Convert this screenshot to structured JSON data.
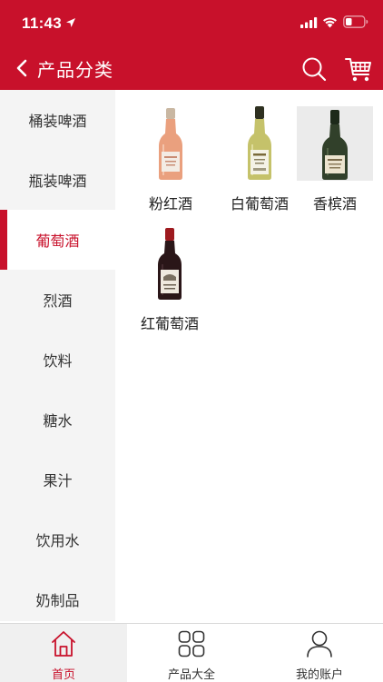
{
  "status_bar": {
    "time": "11:43"
  },
  "nav": {
    "title": "产品分类",
    "icons": [
      "back-chevron-icon",
      "search-icon",
      "cart-icon"
    ]
  },
  "colors": {
    "accent": "#c8112b",
    "sidebar_bg": "#f4f4f4"
  },
  "sidebar": {
    "items": [
      {
        "label": "桶装啤酒",
        "active": false
      },
      {
        "label": "瓶装啤酒",
        "active": false
      },
      {
        "label": "葡萄酒",
        "active": true
      },
      {
        "label": "烈酒",
        "active": false
      },
      {
        "label": "饮料",
        "active": false
      },
      {
        "label": "糖水",
        "active": false
      },
      {
        "label": "果汁",
        "active": false
      },
      {
        "label": "饮用水",
        "active": false
      },
      {
        "label": "奶制品",
        "active": false
      }
    ]
  },
  "products": [
    {
      "name": "粉红酒",
      "icon": "rose-wine-bottle"
    },
    {
      "name": "白葡萄酒",
      "icon": "white-wine-bottle"
    },
    {
      "name": "香槟酒",
      "icon": "champagne-bottle"
    },
    {
      "name": "红葡萄酒",
      "icon": "red-wine-bottle"
    }
  ],
  "tabbar": {
    "tabs": [
      {
        "label": "首页",
        "icon": "home-icon",
        "active": true
      },
      {
        "label": "产品大全",
        "icon": "grid-icon",
        "active": false
      },
      {
        "label": "我的账户",
        "icon": "user-icon",
        "active": false
      }
    ]
  }
}
